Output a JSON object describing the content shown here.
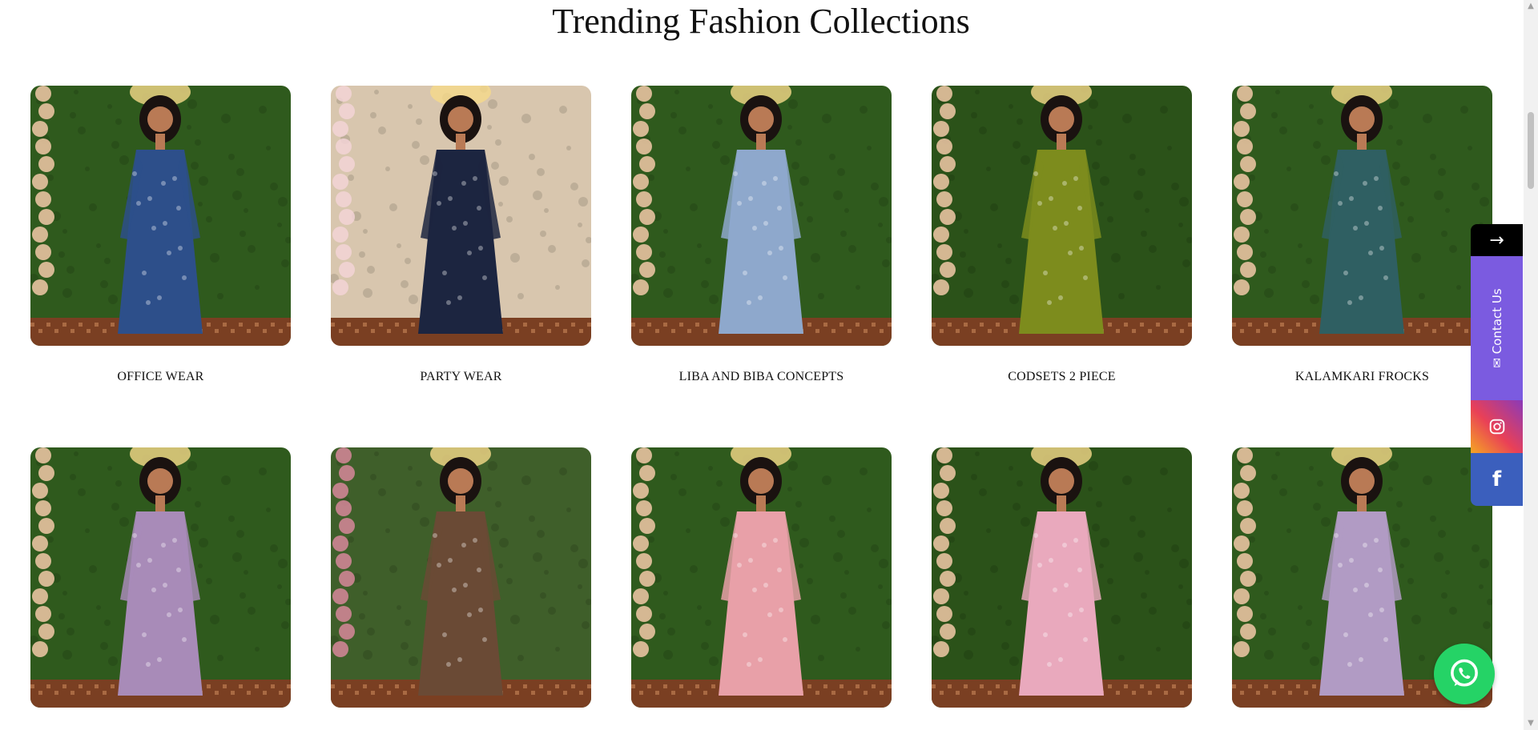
{
  "section": {
    "title": "Trending Fashion Collections"
  },
  "collections": [
    {
      "label": "OFFICE WEAR",
      "bg": "#2f5a1d",
      "dress": "#2d4f8a",
      "flowers": "#f2c9a8"
    },
    {
      "label": "PARTY WEAR",
      "bg": "#d8c6ae",
      "dress": "#1c2540",
      "flowers": "#f3d3d6"
    },
    {
      "label": "LIBA AND BIBA CONCEPTS",
      "bg": "#2f5a1d",
      "dress": "#8ea8cc",
      "flowers": "#f2c9a8"
    },
    {
      "label": "CODSETS 2 PIECE",
      "bg": "#2b5219",
      "dress": "#7d8c1d",
      "flowers": "#f2c9a8"
    },
    {
      "label": "KALAMKARI FROCKS",
      "bg": "#2f5a1d",
      "dress": "#2f5f62",
      "flowers": "#f2c9a8"
    },
    {
      "label": "",
      "bg": "#2f5a1d",
      "dress": "#a88bb8",
      "flowers": "#f2c9a8"
    },
    {
      "label": "",
      "bg": "#3f5f2a",
      "dress": "#6a4a35",
      "flowers": "#d7879a"
    },
    {
      "label": "",
      "bg": "#2f5a1d",
      "dress": "#e8a0a8",
      "flowers": "#f2c9a8"
    },
    {
      "label": "",
      "bg": "#2b5219",
      "dress": "#e9a9bd",
      "flowers": "#f2c9a8"
    },
    {
      "label": "",
      "bg": "#2f5a1d",
      "dress": "#b19bc4",
      "flowers": "#f2c9a8"
    }
  ],
  "side_widget": {
    "arrow_icon": "→",
    "contact_label": "✉ Contact Us",
    "instagram_icon": "instagram-icon",
    "facebook_icon": "f"
  },
  "whatsapp": {
    "icon": "whatsapp-icon"
  },
  "colors": {
    "accent_purple": "#7b5be0",
    "facebook_blue": "#3b5fbd",
    "whatsapp_green": "#25d366"
  }
}
